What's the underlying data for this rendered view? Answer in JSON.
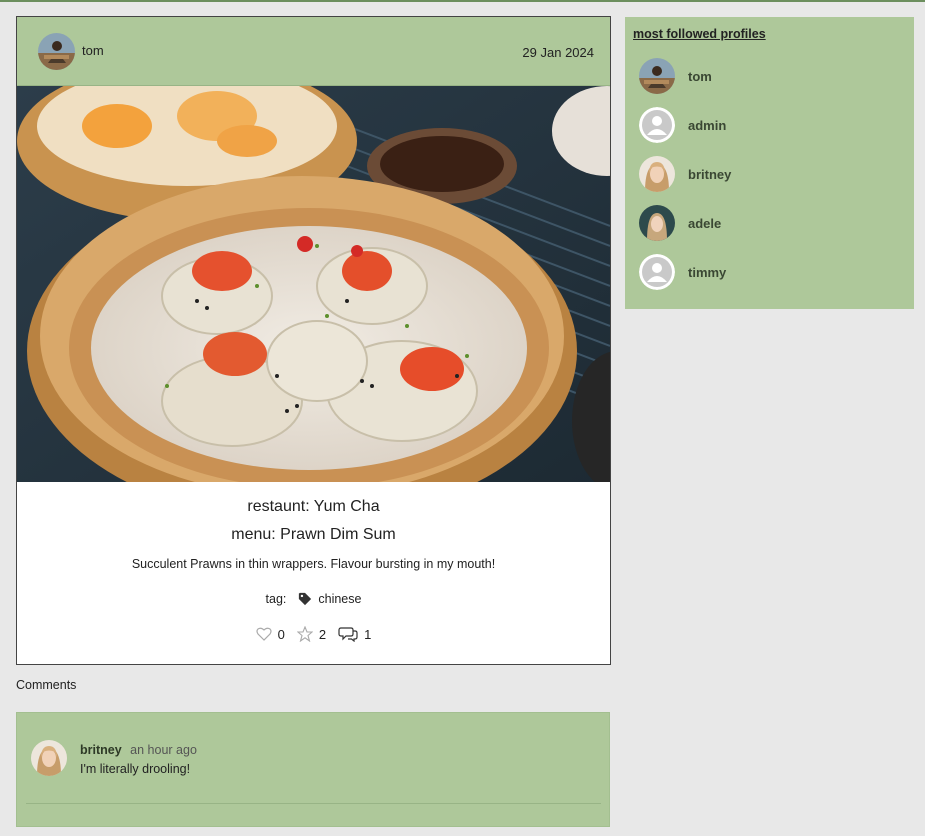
{
  "post": {
    "author": "tom",
    "date": "29 Jan 2024",
    "image_alt": "Prawn Dim Sum",
    "restaurant": "restaunt: Yum Cha",
    "menu": "menu: Prawn Dim Sum",
    "description": "Succulent Prawns in thin wrappers. Flavour bursting in my mouth!",
    "tag_label": "tag:",
    "tag": "chinese",
    "likes": "0",
    "stars": "2",
    "comments_count": "1"
  },
  "comments_section": {
    "label": "Comments",
    "items": [
      {
        "author": "britney",
        "time": "an hour ago",
        "text": "I'm literally drooling!"
      }
    ]
  },
  "sidebar": {
    "title": "most followed profiles",
    "profiles": [
      {
        "name": "tom"
      },
      {
        "name": "admin"
      },
      {
        "name": "britney"
      },
      {
        "name": "adele"
      },
      {
        "name": "timmy"
      }
    ]
  },
  "colors": {
    "accent_green": "#aec89a",
    "page_bg": "#e8e8e8"
  },
  "icons": {
    "like": "heart-outline-icon",
    "star": "star-outline-icon",
    "comment": "speech-bubbles-icon",
    "tag": "tag-icon"
  }
}
